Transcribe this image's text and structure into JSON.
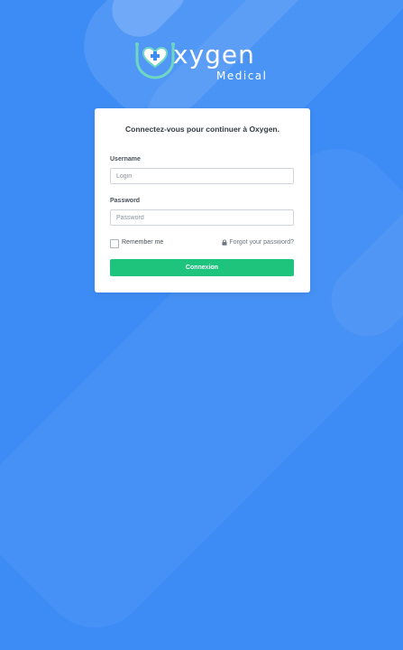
{
  "brand": {
    "name": "xygen",
    "subtitle": "Medical",
    "logo_icon": "stethoscope-heart-icon"
  },
  "login": {
    "title": "Connectez-vous pour continuer à Oxygen.",
    "username_label": "Username",
    "username_placeholder": "Login",
    "password_label": "Password",
    "password_placeholder": "Password",
    "remember_label": "Remember me",
    "forgot_label": "Forgot your password?",
    "forgot_icon": "lock-icon",
    "submit_label": "Connexion"
  },
  "colors": {
    "background": "#3d8cf5",
    "submit": "#1ec47c",
    "logo_accent": "#6fd6c2"
  }
}
